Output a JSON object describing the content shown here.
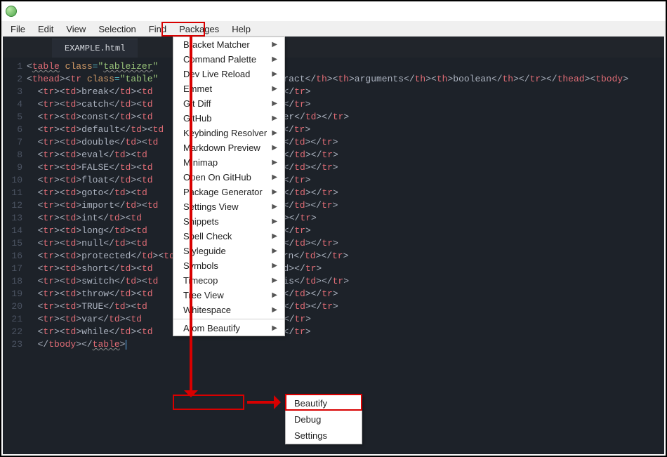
{
  "menubar": {
    "items": [
      "File",
      "Edit",
      "View",
      "Selection",
      "Find",
      "Packages",
      "Help"
    ]
  },
  "tab": {
    "name": "EXAMPLE.html"
  },
  "dropdown": {
    "items": [
      "Bracket Matcher",
      "Command Palette",
      "Dev Live Reload",
      "Emmet",
      "Git Diff",
      "GitHub",
      "Keybinding Resolver",
      "Markdown Preview",
      "Minimap",
      "Open On GitHub",
      "Package Generator",
      "Settings View",
      "Snippets",
      "Spell Check",
      "Styleguide",
      "Symbols",
      "Timecop",
      "Tree View",
      "Whitespace"
    ],
    "last": "Atom Beautify"
  },
  "submenu": {
    "items": [
      "Beautify",
      "Debug",
      "Settings"
    ]
  },
  "code": {
    "table_open_prefix": "<table class=\"tableizer",
    "thead_prefix": "<thead><tr class=\"table",
    "thead_cells": [
      "ract",
      "arguments",
      "boolean"
    ],
    "rows": [
      {
        "w": "break",
        "tail": "</tr>"
      },
      {
        "w": "catch",
        "tail": "</tr>"
      },
      {
        "w": "const",
        "tail": "er</td></tr>"
      },
      {
        "w": "default",
        "tail": "</tr>"
      },
      {
        "w": "double",
        "tail": "</td></tr>"
      },
      {
        "w": "eval",
        "tail": "</td></tr>"
      },
      {
        "w": "FALSE",
        "tail": "</td></tr>"
      },
      {
        "w": "float",
        "tail": "</tr>"
      },
      {
        "w": "goto",
        "tail": "</td></tr>"
      },
      {
        "w": "import",
        "tail": "</td></tr>"
      },
      {
        "w": "int",
        "tail": "></tr>"
      },
      {
        "w": "long",
        "tail": "</tr>"
      },
      {
        "w": "null",
        "tail": "</td></tr>"
      },
      {
        "w": "protected",
        "tail": "rn</td></tr>"
      },
      {
        "w": "short",
        "tail": "d></tr>"
      },
      {
        "w": "switch",
        "tail": "is</td></tr>"
      },
      {
        "w": "throw",
        "tail": "</td></tr>"
      },
      {
        "w": "TRUE",
        "tail": "</td></tr>"
      },
      {
        "w": "var",
        "tail": "</tr>"
      },
      {
        "w": "while",
        "tail": "</tr>"
      }
    ],
    "close": "</tbody></table>"
  }
}
